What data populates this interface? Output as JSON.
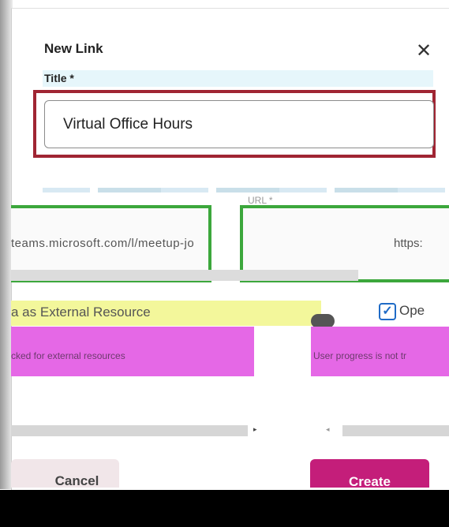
{
  "dialog": {
    "title": "New Link",
    "close_glyph": "✕",
    "title_field": {
      "label": "Title *",
      "value": "Virtual Office Hours"
    }
  },
  "distorted": {
    "url_label": "URL *",
    "url_fragment_left": "teams.microsoft.com/l/meetup-jo",
    "url_fragment_right": "https:",
    "external_resource_text": "a as External Resource",
    "open_new_window_text": "Ope",
    "checkbox_glyph": "✓",
    "external_note_left": "cked for external resources",
    "external_note_right": "User progress is not tr",
    "scroll_right_glyph": "▸",
    "scroll_left_glyph": "◂"
  },
  "actions": {
    "cancel_label": "Cancel",
    "create_label": "Create"
  },
  "colors": {
    "highlight_border": "#a02533",
    "create_button": "#c41e7a",
    "accent_blue": "#1f6bc6"
  },
  "icons": [
    "close-icon",
    "checkbox-check-icon",
    "scroll-right-icon",
    "scroll-left-icon"
  ]
}
